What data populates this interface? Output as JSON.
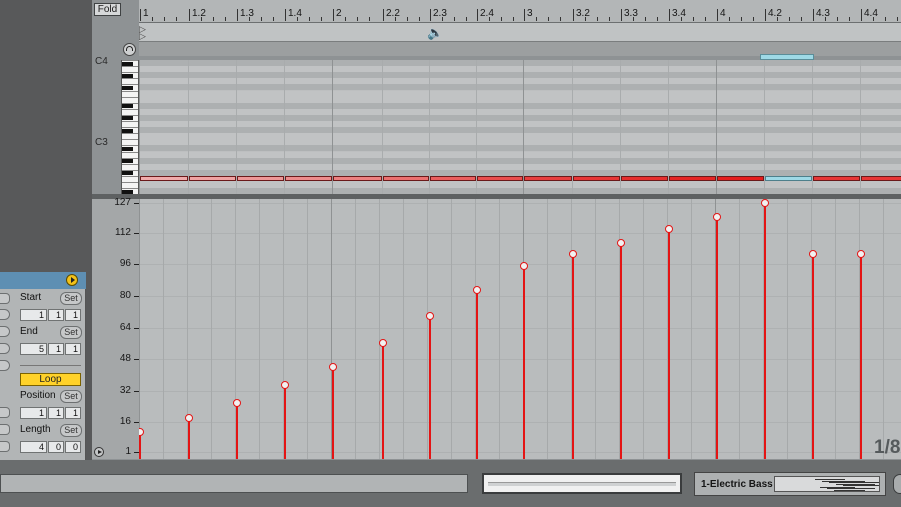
{
  "header": {
    "fold_label": "Fold",
    "ruler_labels": [
      "1",
      "1.2",
      "1.3",
      "1.4",
      "2",
      "2.2",
      "2.3",
      "2.4",
      "3",
      "3.2",
      "3.3",
      "3.4",
      "4",
      "4.2",
      "4.3",
      "4.4"
    ]
  },
  "piano": {
    "octave_labels": [
      "C4",
      "C3"
    ]
  },
  "velocity": {
    "scale_labels": [
      "127",
      "112",
      "96",
      "80",
      "64",
      "48",
      "32",
      "16",
      "1"
    ],
    "values": [
      11,
      18,
      26,
      35,
      44,
      56,
      70,
      83,
      95,
      101,
      107,
      114,
      120,
      127,
      101,
      101
    ]
  },
  "clip_box": {
    "start_label": "Start",
    "end_label": "End",
    "position_label": "Position",
    "length_label": "Length",
    "set_label": "Set",
    "loop_label": "Loop",
    "start_values": [
      "1",
      "1",
      "1"
    ],
    "end_values": [
      "5",
      "1",
      "1"
    ],
    "position_values": [
      "1",
      "1",
      "1"
    ],
    "length_values": [
      "4",
      "0",
      "0"
    ]
  },
  "corner_text": "1/8",
  "bottom": {
    "track_name": "1-Electric Bass"
  },
  "colors": {
    "velocity_stem": "#e41414",
    "loop_button": "#ffd22a",
    "loop_marker": "#9ed9e6",
    "note_low": "#f1b9b9",
    "note_high": "#e41414"
  }
}
